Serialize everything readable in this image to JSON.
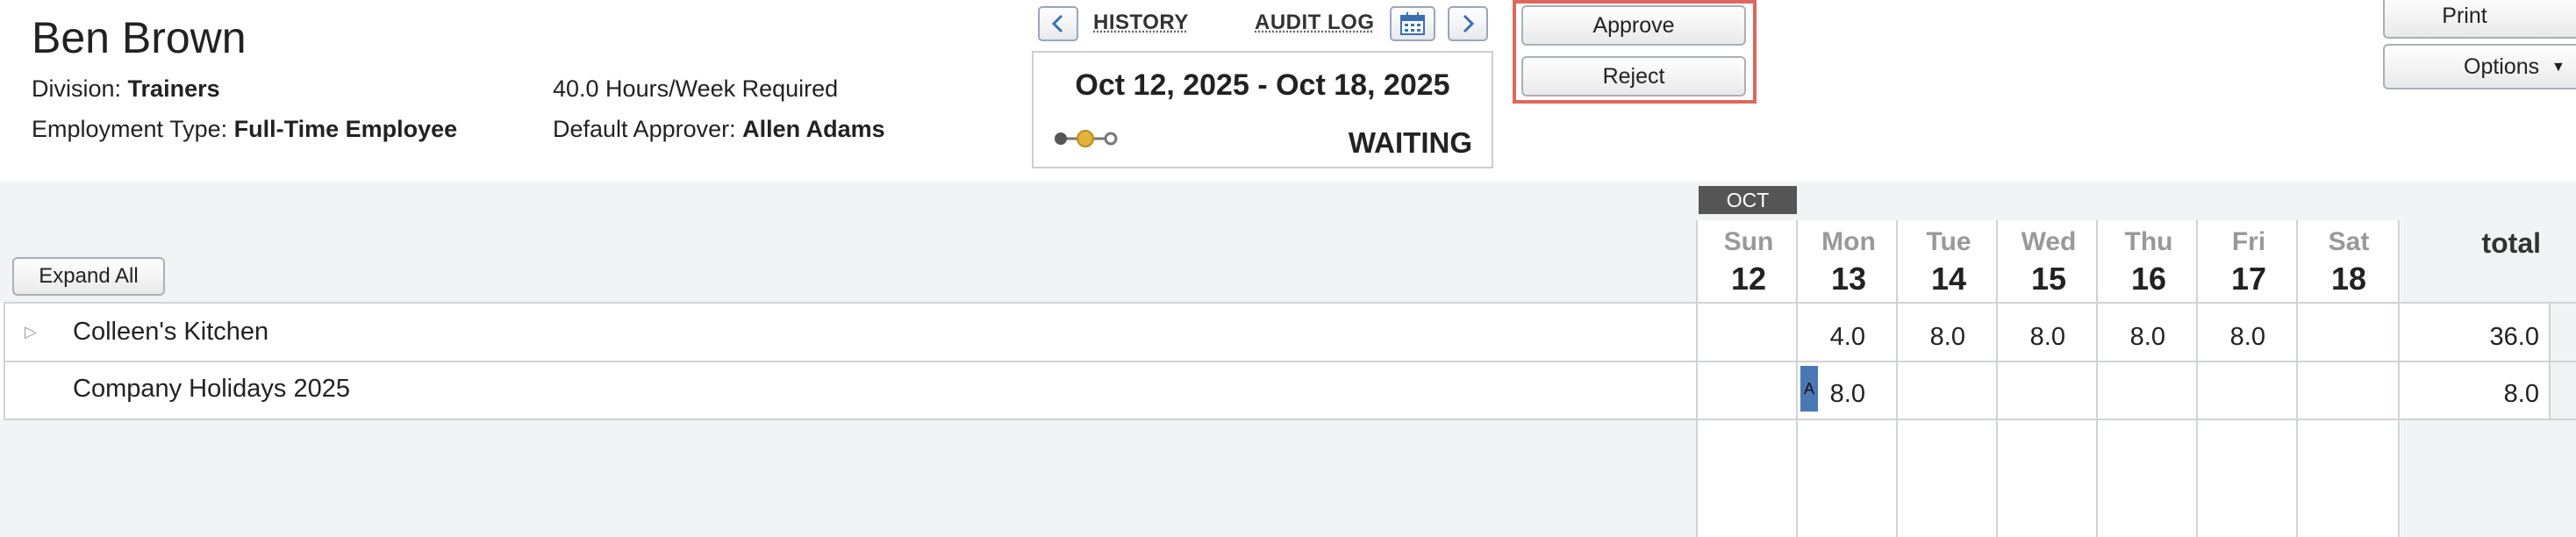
{
  "employee": {
    "name": "Ben Brown",
    "division_label": "Division:",
    "division": "Trainers",
    "employment_type_label": "Employment Type:",
    "employment_type": "Full-Time Employee",
    "hours_required": "40.0 Hours/Week Required",
    "default_approver_label": "Default Approver:",
    "default_approver": "Allen Adams"
  },
  "nav": {
    "history": "HISTORY",
    "audit_log": "AUDIT LOG"
  },
  "period": {
    "dates": "Oct 12, 2025 - Oct 18, 2025",
    "status": "WAITING"
  },
  "actions": {
    "approve": "Approve",
    "reject": "Reject",
    "print": "Print",
    "options": "Options"
  },
  "grid": {
    "expand_all": "Expand All",
    "month_label": "OCT",
    "total_header": "total",
    "days": [
      {
        "name": "Sun",
        "num": "12"
      },
      {
        "name": "Mon",
        "num": "13"
      },
      {
        "name": "Tue",
        "num": "14"
      },
      {
        "name": "Wed",
        "num": "15"
      },
      {
        "name": "Thu",
        "num": "16"
      },
      {
        "name": "Fri",
        "num": "17"
      },
      {
        "name": "Sat",
        "num": "18"
      }
    ],
    "rows": [
      {
        "label": "Colleen's Kitchen",
        "values": [
          "",
          "4.0",
          "8.0",
          "8.0",
          "8.0",
          "8.0",
          ""
        ],
        "total": "36.0"
      },
      {
        "label": "Company Holidays 2025",
        "marker": "A",
        "values": [
          "",
          "8.0",
          "",
          "",
          "",
          "",
          ""
        ],
        "total": "8.0"
      }
    ]
  },
  "colors": {
    "highlight": "#e0665c",
    "status_active": "#e3b33c",
    "marker_bg": "#4a78b5",
    "month_badge_bg": "#555555"
  }
}
